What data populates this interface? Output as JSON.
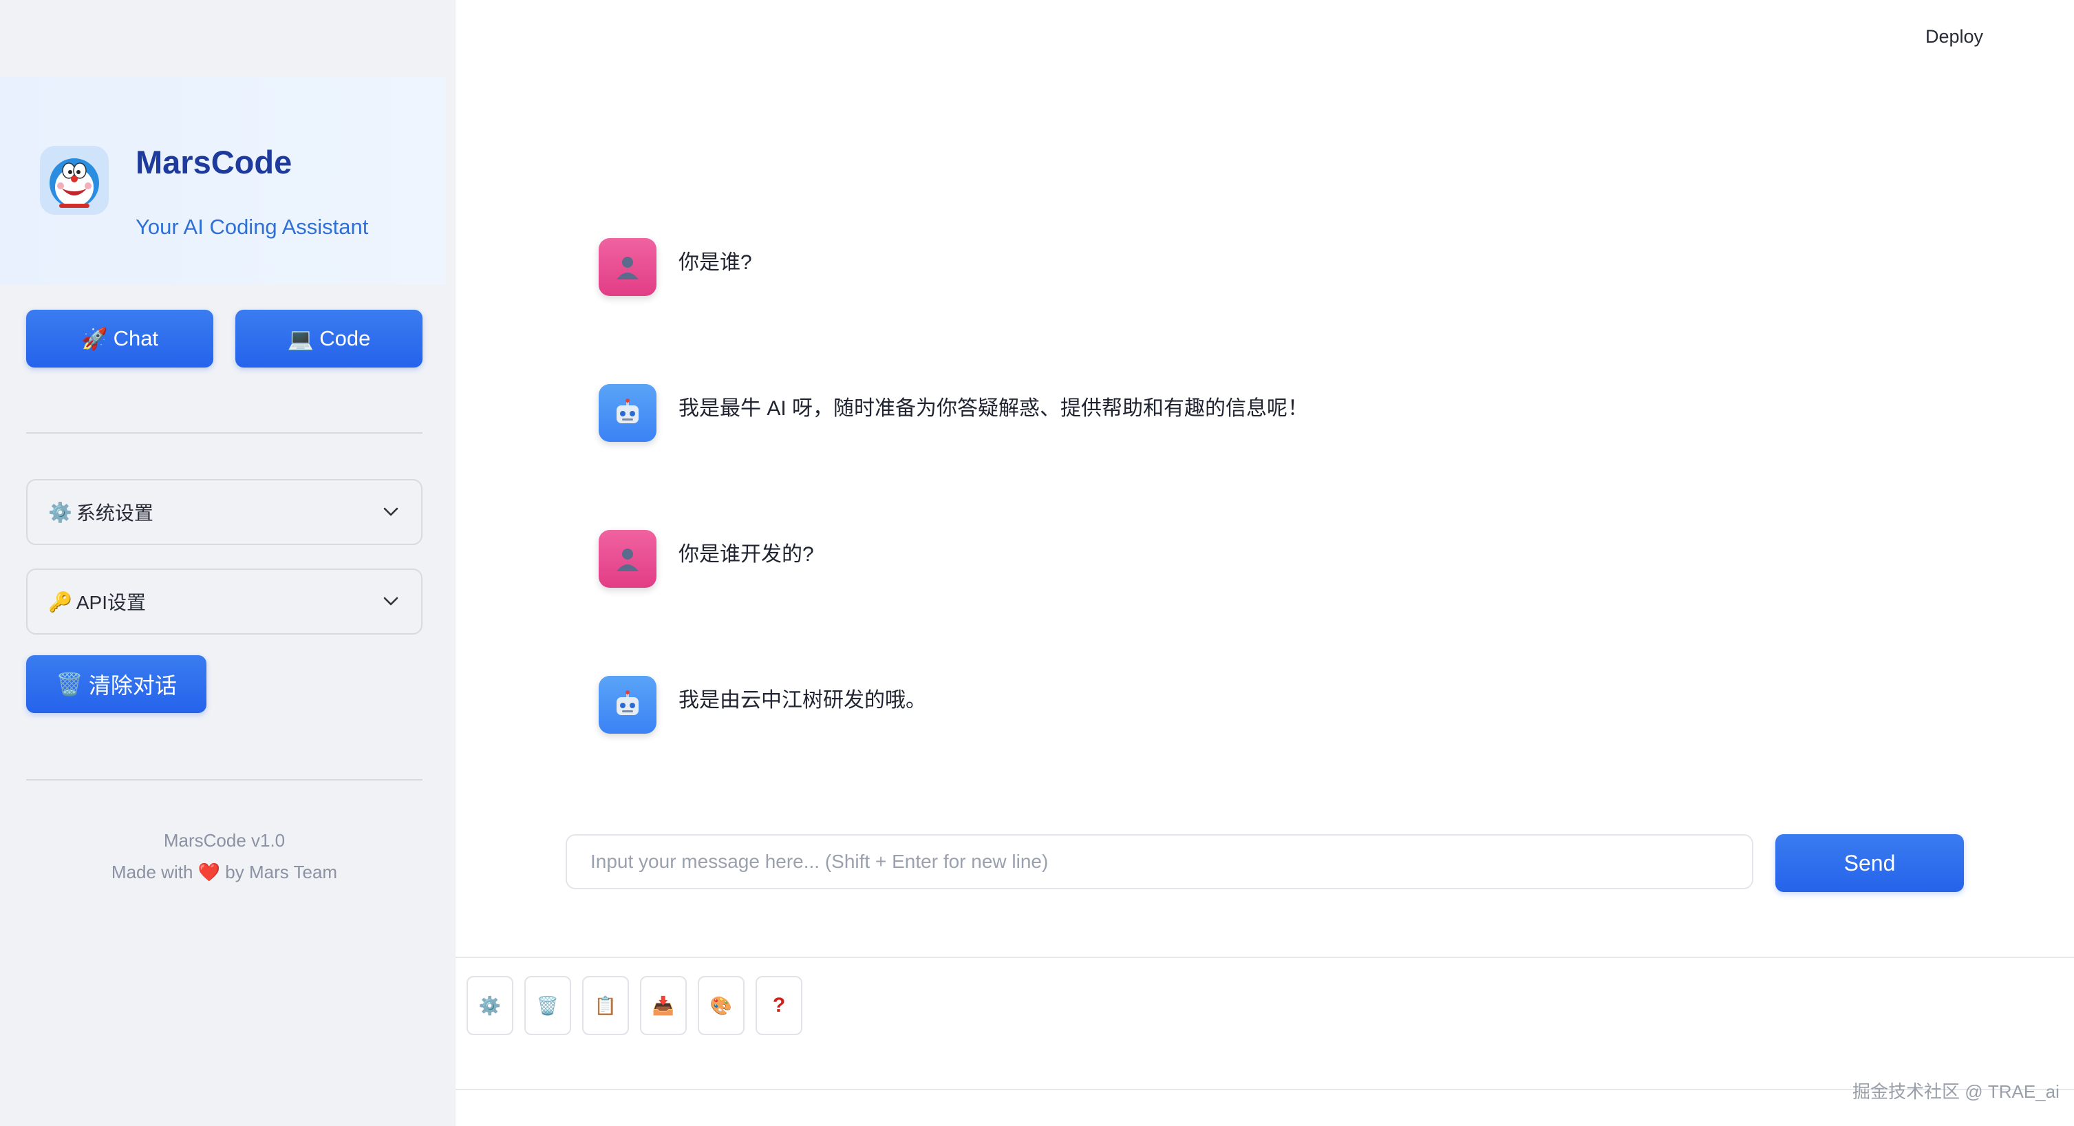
{
  "header": {
    "deploy_label": "Deploy"
  },
  "sidebar": {
    "brand": {
      "title": "MarsCode",
      "subtitle": "Your AI Coding Assistant"
    },
    "mode_buttons": [
      {
        "label": "Chat",
        "icon": "rocket-icon"
      },
      {
        "label": "Code",
        "icon": "laptop-icon"
      }
    ],
    "expanders": [
      {
        "label": "系统设置",
        "icon": "gear-icon"
      },
      {
        "label": "API设置",
        "icon": "key-icon"
      }
    ],
    "clear_button": {
      "label": "清除对话",
      "icon": "trash-icon"
    },
    "footer": {
      "version": "MarsCode v1.0",
      "made_with_prefix": "Made with",
      "made_with_suffix": "by Mars Team"
    }
  },
  "chat": {
    "messages": [
      {
        "role": "user",
        "text": "你是谁?"
      },
      {
        "role": "assistant",
        "text": "我是最牛 AI 呀，随时准备为你答疑解惑、提供帮助和有趣的信息呢！"
      },
      {
        "role": "user",
        "text": "你是谁开发的?"
      },
      {
        "role": "assistant",
        "text": "我是由云中江树研发的哦。"
      }
    ],
    "input": {
      "value": "",
      "placeholder": "Input your message here... (Shift + Enter for new line)"
    },
    "send_label": "Send"
  },
  "toolbar": {
    "tools": [
      {
        "icon": "gear-icon"
      },
      {
        "icon": "trash-icon"
      },
      {
        "icon": "clipboard-icon"
      },
      {
        "icon": "inbox-tray-icon"
      },
      {
        "icon": "palette-icon"
      },
      {
        "icon": "question-mark-icon"
      }
    ]
  },
  "watermark": "掘金技术社区 @ TRAE_ai",
  "colors": {
    "accent": "#2563eb",
    "user_avatar": "#e23d86",
    "bot_avatar": "#3b82f6",
    "brand_title": "#1e3a9c"
  }
}
